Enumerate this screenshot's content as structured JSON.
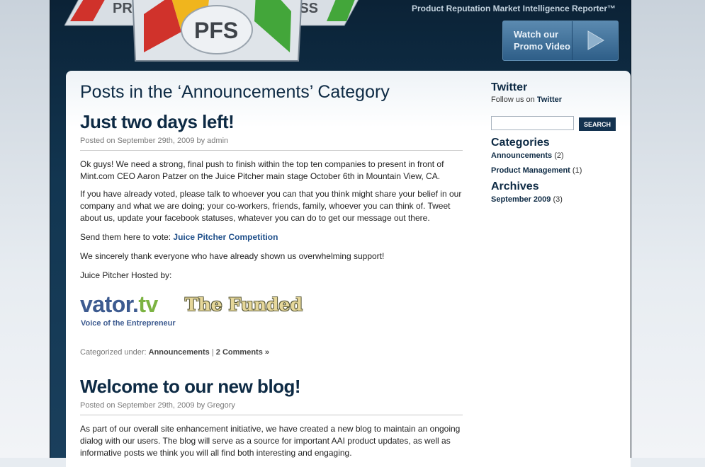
{
  "header": {
    "logo_text": "PFS",
    "logo_left_text": "PRS",
    "logo_right_text": "PSS",
    "tagline": "Product Reputation Market Intelligence Reporter™",
    "promo_line1": "Watch our",
    "promo_line2": "Promo Video"
  },
  "main": {
    "page_heading": "Posts in the ‘Announcements’ Category",
    "posts": [
      {
        "title": "Just two days left!",
        "meta": "Posted on September 29th, 2009 by admin",
        "p1": "Ok guys! We need a strong, final push to finish within the top ten companies to present in front of Mint.com CEO Aaron Patzer on the Juice Pitcher main stage October 6th in Mountain View, CA.",
        "p2": "If you have already voted, please talk to whoever you can that you think might share your belief in our company and what we are doing; your co-workers, friends, family, whoever you can think of. Tweet about us, update your facebook statuses, whatever you can do to get our message out there.",
        "p3_prefix": "Send them here to vote: ",
        "p3_link": "Juice Pitcher Competition",
        "p4": "We sincerely thank everyone who have already shown us overwhelming support!",
        "p5": "Juice Pitcher Hosted by:",
        "sponsor1_name": "vator.",
        "sponsor1_tld": "tv",
        "sponsor1_tagline": "Voice of the Entrepreneur",
        "sponsor2_name": "The Funded",
        "categorized_label": "Categorized under: ",
        "category_link": "Announcements",
        "separator": " | ",
        "comments_link": "2 Comments »"
      },
      {
        "title": "Welcome to our new blog!",
        "meta": "Posted on September 29th, 2009 by Gregory",
        "p1": "As part of our overall site enhancement initiative, we have created a new blog to maintain an ongoing dialog with our users.  The blog will serve as a source for important AAI  product updates, as well as  informative posts we think you will all find both interesting and engaging."
      }
    ]
  },
  "sidebar": {
    "twitter_heading": "Twitter",
    "twitter_text": "Follow us on ",
    "twitter_link": "Twitter",
    "search_button": "SEARCH",
    "search_value": "",
    "categories_heading": "Categories",
    "categories": [
      {
        "name": "Announcements",
        "count": "(2)"
      },
      {
        "name": "Product Management",
        "count": "(1)"
      }
    ],
    "archives_heading": "Archives",
    "archives": [
      {
        "name": "September 2009",
        "count": "(3)"
      }
    ]
  },
  "colors": {
    "header_bg": "#123651",
    "heading": "#0d2a44",
    "link": "#1f4f8a",
    "search_button": "#13324f"
  }
}
